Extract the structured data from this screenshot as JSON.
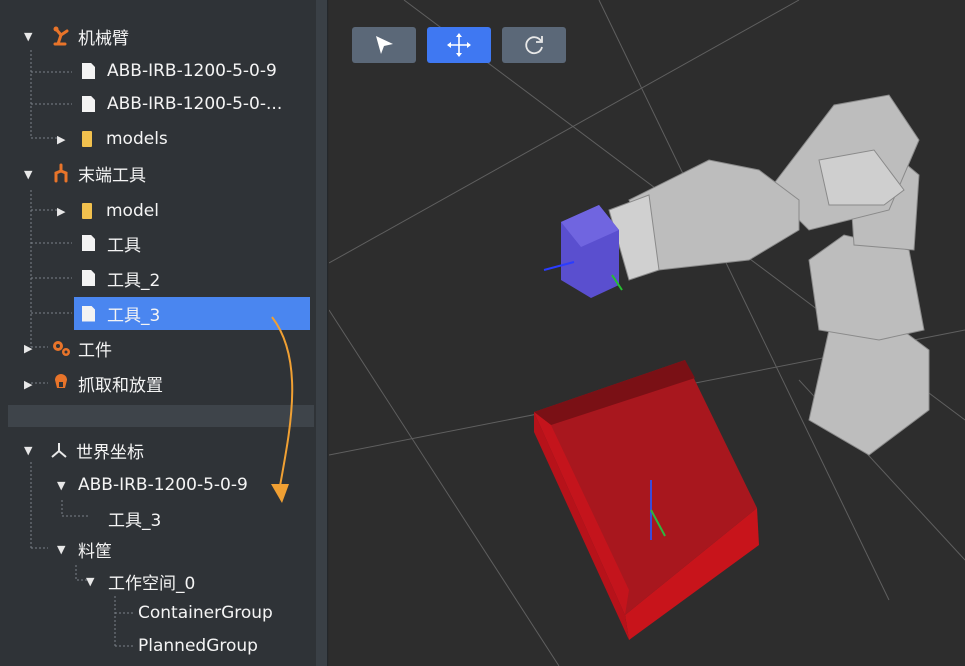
{
  "tree_top": {
    "root": {
      "label": "机械臂"
    },
    "files": [
      "ABB-IRB-1200-5-0-9",
      "ABB-IRB-1200-5-0-..."
    ],
    "models_folder": "models",
    "tool_root": {
      "label": "末端工具"
    },
    "tool_folder": "model",
    "tool_files": [
      "工具",
      "工具_2",
      "工具_3"
    ],
    "workpiece": "工件",
    "pick_place": "抓取和放置"
  },
  "tree_bottom": {
    "world": "世界坐标",
    "robot": "ABB-IRB-1200-5-0-9",
    "robot_child": "工具_3",
    "bin": "料筐",
    "workspace": "工作空间_0",
    "groups": [
      "ContainerGroup",
      "PlannedGroup"
    ]
  },
  "toolbar": {
    "select_icon": "pointer-icon",
    "move_icon": "move-icon",
    "rotate_icon": "rotate-icon"
  },
  "colors": {
    "selection": "#4a86f0",
    "accent": "#e8742a",
    "active_tool": "#3f78f2",
    "container": "#c4141c",
    "tool_cube": "#5a4fcf"
  }
}
